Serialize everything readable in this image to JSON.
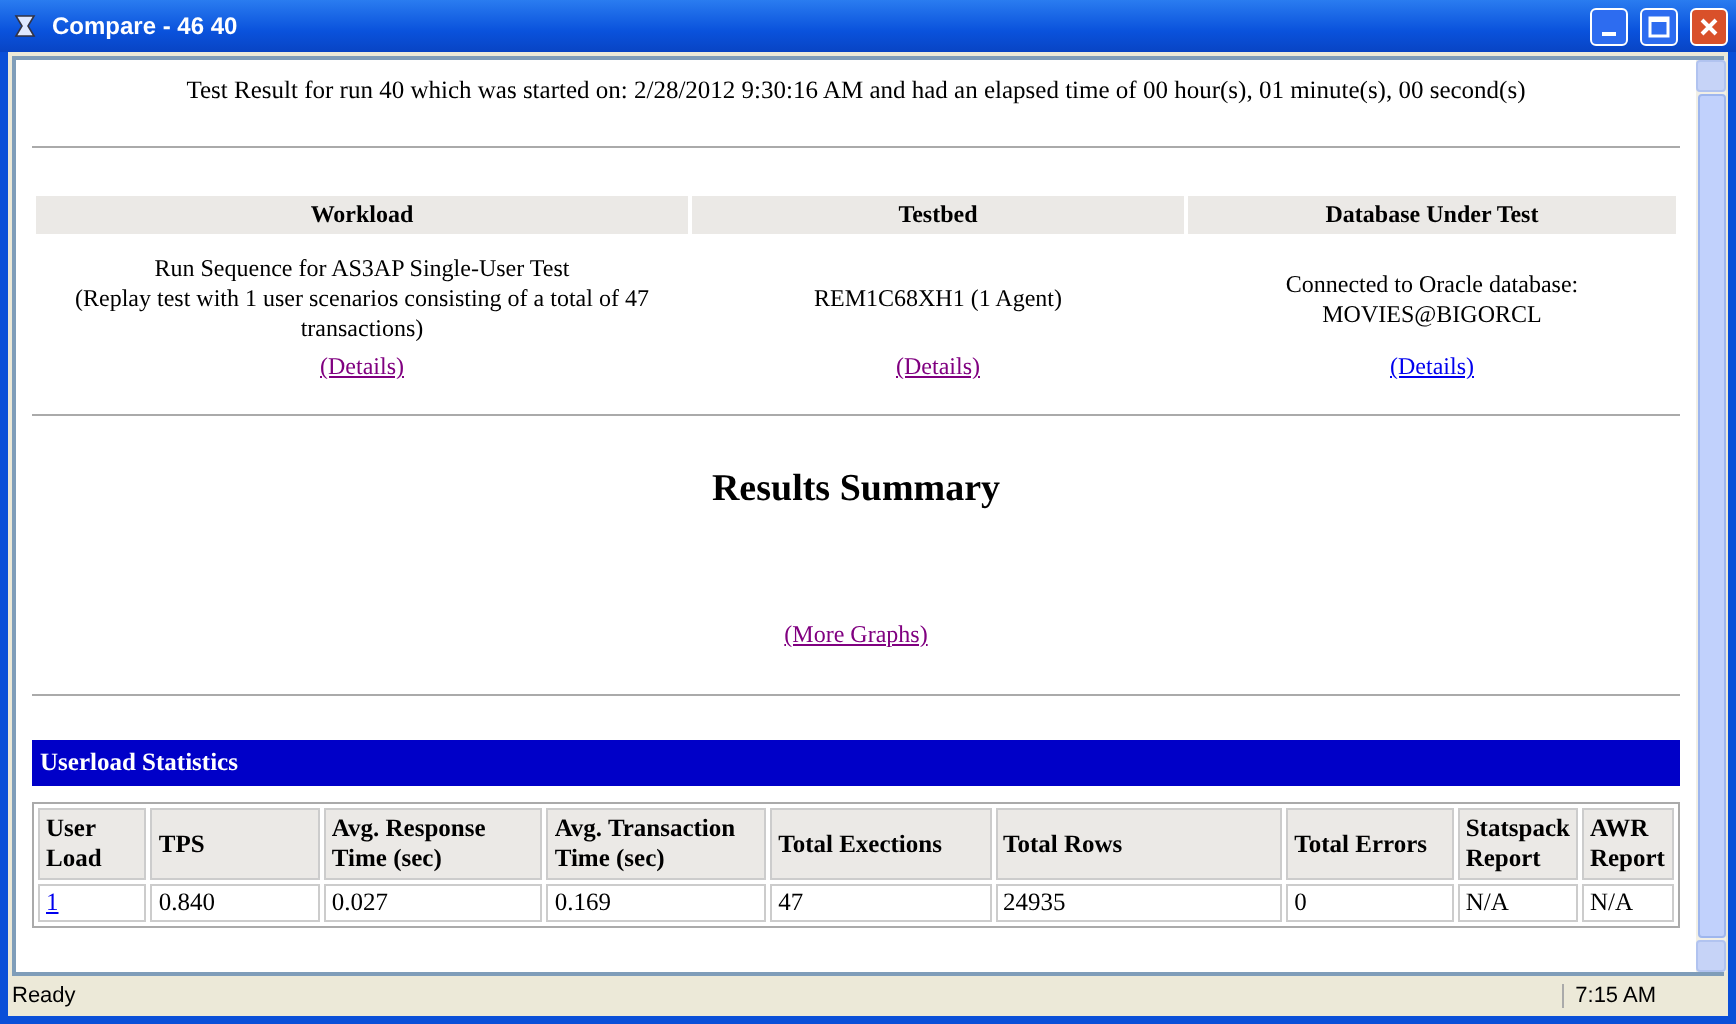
{
  "window": {
    "title": "Compare - 46 40"
  },
  "header": "Test Result for run 40 which was started on: 2/28/2012 9:30:16 AM and had an elapsed time of 00 hour(s), 01 minute(s), 00 second(s)",
  "info_columns": [
    {
      "heading": "Workload",
      "lines": [
        "Run Sequence for AS3AP Single-User Test",
        "(Replay test with 1 user scenarios consisting of a total of 47 transactions)"
      ],
      "link": {
        "label": "(Details)",
        "visited": true
      }
    },
    {
      "heading": "Testbed",
      "lines": [
        "REM1C68XH1 (1 Agent)"
      ],
      "link": {
        "label": "(Details)",
        "visited": true
      }
    },
    {
      "heading": "Database Under Test",
      "lines": [
        "Connected to Oracle database:",
        "MOVIES@BIGORCL"
      ],
      "link": {
        "label": "(Details)",
        "visited": false
      }
    }
  ],
  "summary": {
    "title": "Results Summary",
    "link": {
      "label": "(More Graphs)",
      "visited": true
    }
  },
  "userload": {
    "title": "Userload Statistics",
    "columns": [
      "User Load",
      "TPS",
      "Avg. Response Time (sec)",
      "Avg. Transaction Time (sec)",
      "Total Exections",
      "Total Rows",
      "Total Errors",
      "Statspack Report",
      "AWR Report"
    ],
    "rows": [
      {
        "cells": [
          "1",
          "0.840",
          "0.027",
          "0.169",
          "47",
          "24935",
          "0",
          "N/A",
          "N/A"
        ]
      }
    ]
  },
  "status_bar": {
    "text": "Ready",
    "time": "7:15 AM"
  }
}
